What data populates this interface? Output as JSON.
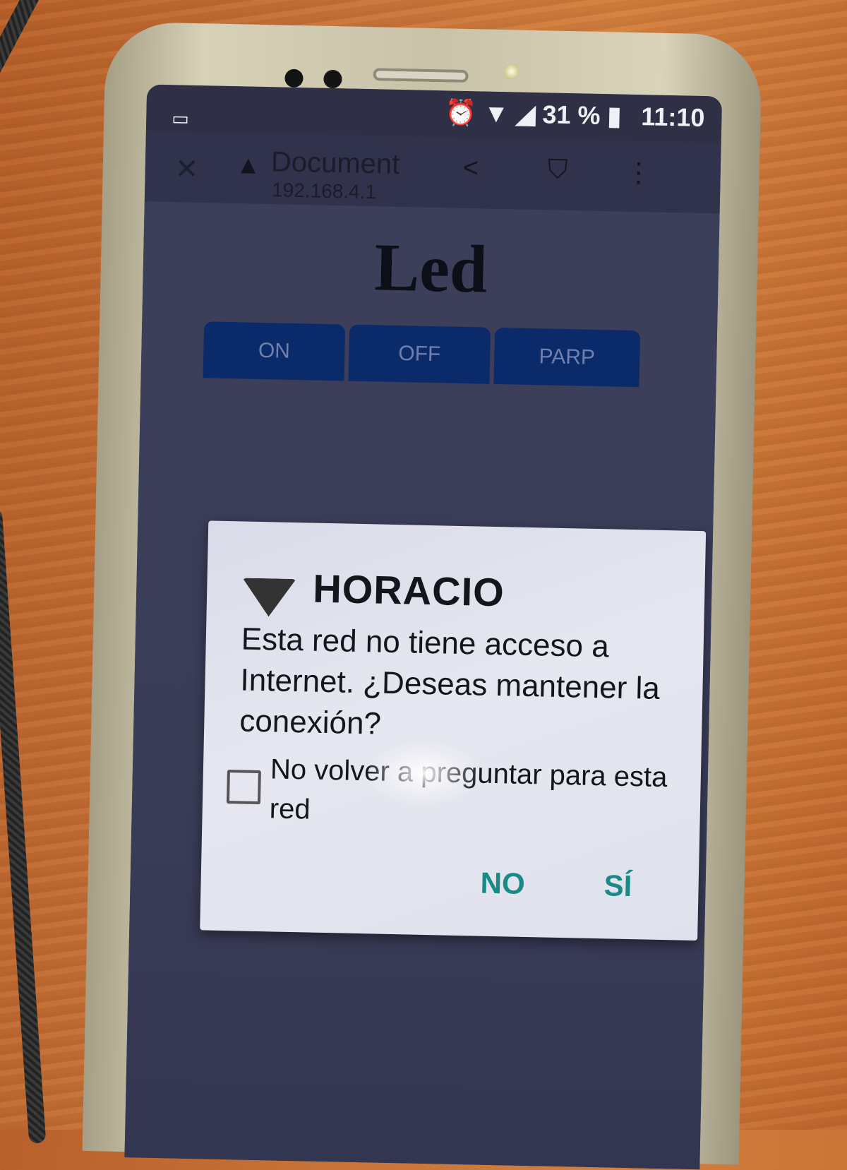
{
  "status_bar": {
    "left_icon": "laptop-icon",
    "alarm_icon": "alarm-icon",
    "wifi_icon": "wifi-no-internet-icon",
    "signal_icon": "signal-icon",
    "battery_text": "31 %",
    "battery_icon": "battery-icon",
    "time": "11:10"
  },
  "browser_bar": {
    "close_icon": "close-icon",
    "warning_icon": "warning-icon",
    "title": "Document",
    "url": "192.168.4.1",
    "share_icon": "share-icon",
    "bookmark_icon": "bookmark-icon",
    "menu_icon": "more-vert-icon"
  },
  "page": {
    "title": "Led",
    "buttons": [
      "ON",
      "OFF",
      "PARP"
    ]
  },
  "dialog": {
    "network_name": "HORACIO",
    "message": "Esta red no tiene acceso a Internet. ¿Deseas mantener la conexión?",
    "checkbox_label": "No volver a preguntar para esta red",
    "checkbox_checked": false,
    "no_label": "NO",
    "yes_label": "SÍ",
    "accent_color": "#1a8a86"
  }
}
